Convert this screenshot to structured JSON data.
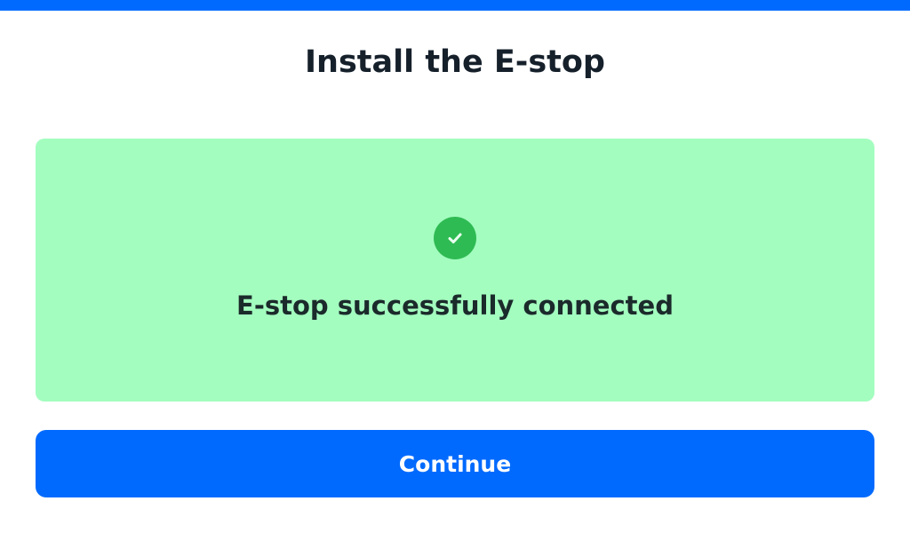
{
  "header": {
    "title": "Install the E-stop"
  },
  "status": {
    "icon": "check-circle-icon",
    "message": "E-stop successfully connected"
  },
  "actions": {
    "continue_label": "Continue"
  },
  "colors": {
    "accent": "#006aff",
    "success_panel": "#a3fdbf",
    "success_icon": "#2fbb53",
    "text_dark": "#15202b"
  }
}
